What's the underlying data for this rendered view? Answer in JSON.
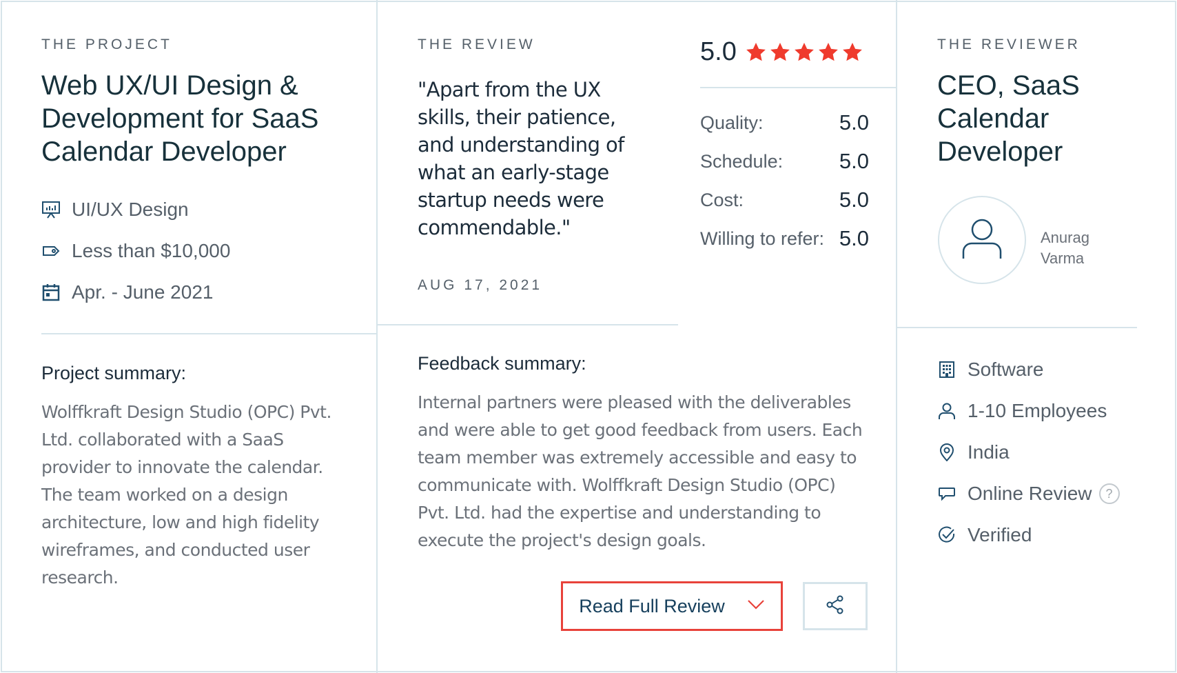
{
  "project": {
    "eyebrow": "THE PROJECT",
    "title_lines": [
      "Web UX/UI Design &",
      "Development for SaaS",
      "Calendar Developer"
    ],
    "meta": [
      {
        "icon": "presentation-chart-icon",
        "text": "UI/UX Design"
      },
      {
        "icon": "price-tag-icon",
        "text": "Less than $10,000"
      },
      {
        "icon": "calendar-icon",
        "text": "Apr. - June 2021"
      }
    ],
    "summary_label": "Project summary:",
    "summary_lines": [
      "Wolffkraft Design Studio (OPC) Pvt.",
      "Ltd. collaborated with a SaaS",
      "provider to innovate the calendar.",
      "The team worked on a design",
      "architecture, low and high fidelity",
      "wireframes, and conducted user",
      "research."
    ]
  },
  "review": {
    "eyebrow": "THE REVIEW",
    "quote_lines": [
      "\"Apart from the UX",
      "skills, their patience,",
      "and understanding of",
      "what an early-stage",
      "startup needs were",
      "commendable.\""
    ],
    "date": "AUG 17, 2021",
    "overall": "5.0",
    "stars": 5,
    "ratings": [
      {
        "label": "Quality:",
        "value": "5.0"
      },
      {
        "label": "Schedule:",
        "value": "5.0"
      },
      {
        "label": "Cost:",
        "value": "5.0"
      },
      {
        "label": "Willing to refer:",
        "value": "5.0"
      }
    ],
    "feedback_label": "Feedback summary:",
    "feedback_lines": [
      "Internal partners were pleased with the deliverables",
      "and were able to get good feedback from users. Each",
      "team member was extremely accessible and easy to",
      "communicate with. Wolffkraft Design Studio (OPC)",
      "Pvt. Ltd. had the expertise and understanding to",
      "execute the project's design goals."
    ],
    "read_button": "Read Full Review"
  },
  "reviewer": {
    "eyebrow": "THE REVIEWER",
    "title_lines": [
      "CEO, SaaS",
      "Calendar",
      "Developer"
    ],
    "name_lines": [
      "Anurag",
      "Varma"
    ],
    "details": [
      {
        "icon": "building-icon",
        "text": "Software"
      },
      {
        "icon": "person-icon",
        "text": "1-10 Employees"
      },
      {
        "icon": "location-pin-icon",
        "text": "India"
      },
      {
        "icon": "chat-bubble-icon",
        "text": "Online Review",
        "help": "?"
      },
      {
        "icon": "check-circle-icon",
        "text": "Verified"
      }
    ]
  },
  "colors": {
    "accent_red": "#e8423a",
    "star_red": "#ef3b2d",
    "divider": "#d6e4ea",
    "icon_blue": "#1f4e6e"
  }
}
